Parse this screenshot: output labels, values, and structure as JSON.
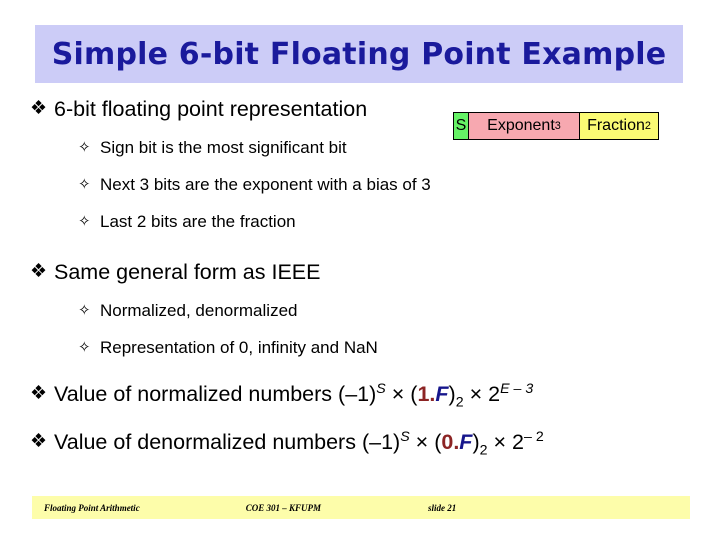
{
  "slide": {
    "title": "Simple 6-bit Floating Point Example",
    "colors": {
      "title_band": "#ccccf7",
      "title_text": "#1a1a9c",
      "sign_cell": "#66f266",
      "exponent_cell": "#f7a8b0",
      "fraction_cell": "#fbfb74",
      "footer_band": "#fdfdaa",
      "leading_digit": "#8c2424",
      "fraction_var": "#16168c"
    },
    "bullet_marker_level1": "❖",
    "bullet_marker_level2": "✧"
  },
  "bitfield": {
    "sign": {
      "label": "S",
      "bits": ""
    },
    "exponent": {
      "label": "Exponent",
      "bits": "3"
    },
    "fraction": {
      "label": "Fraction",
      "bits": "2"
    }
  },
  "sections": [
    {
      "heading": "6-bit floating point representation",
      "items": [
        "Sign bit is the most significant bit",
        "Next 3 bits are the exponent with a bias of 3",
        "Last 2 bits are the fraction"
      ]
    },
    {
      "heading": "Same general form as IEEE",
      "items": [
        "Normalized, denormalized",
        "Representation of 0, infinity and NaN"
      ]
    }
  ],
  "formulas": {
    "normalized": {
      "lead": "Value of normalized numbers",
      "sign_base": "(–1)",
      "sign_exp": "S",
      "times1": "×",
      "open_paren": "(",
      "leading_digit": "1.",
      "fraction_var": "F",
      "close_paren": ")",
      "radix": "2",
      "times2": "×",
      "power_base": "2",
      "power_exp": "E – 3"
    },
    "denormalized": {
      "lead": "Value of denormalized numbers",
      "sign_base": "(–1)",
      "sign_exp": "S",
      "times1": "×",
      "open_paren": "(",
      "leading_digit": "0.",
      "fraction_var": "F",
      "close_paren": ")",
      "radix": "2",
      "times2": "×",
      "power_base": "2",
      "power_exp": "– 2"
    }
  },
  "footer": {
    "left": "Floating Point Arithmetic",
    "middle": "COE 301 – KFUPM",
    "right": "slide 21"
  }
}
